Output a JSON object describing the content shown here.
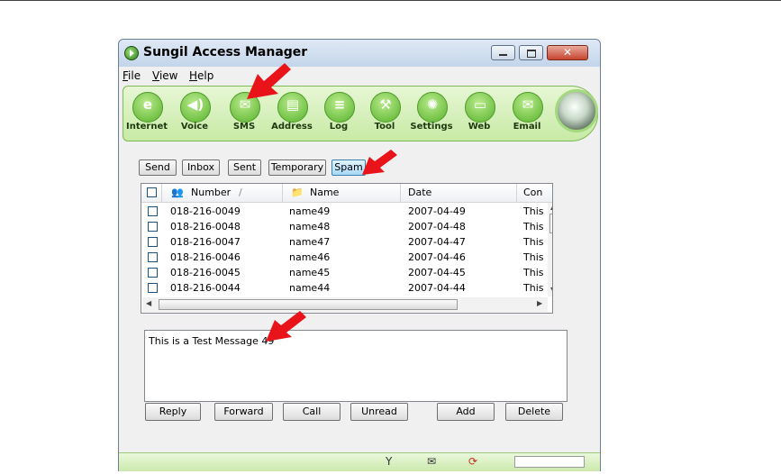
{
  "window": {
    "title": "Sungil Access Manager"
  },
  "menu": [
    "File",
    "View",
    "Help"
  ],
  "toolbar": [
    {
      "label": "Internet",
      "icon": "internet-icon",
      "glyph": "e"
    },
    {
      "label": "Voice",
      "icon": "speaker-icon",
      "glyph": "◀)"
    },
    {
      "label": "SMS",
      "icon": "envelope-icon",
      "glyph": "✉"
    },
    {
      "label": "Address",
      "icon": "address-book-icon",
      "glyph": "▤"
    },
    {
      "label": "Log",
      "icon": "log-icon",
      "glyph": "≡"
    },
    {
      "label": "Tool",
      "icon": "tool-icon",
      "glyph": "⚒"
    },
    {
      "label": "Settings",
      "icon": "gear-icon",
      "glyph": "✺"
    },
    {
      "label": "Web",
      "icon": "web-icon",
      "glyph": "▭"
    },
    {
      "label": "Email",
      "icon": "email-icon",
      "glyph": "✉"
    }
  ],
  "sms_tabs": [
    "Send",
    "Inbox",
    "Sent",
    "Temporary",
    "Spam"
  ],
  "active_tab": "Spam",
  "list": {
    "headers": {
      "number": "Number",
      "name": "Name",
      "date": "Date",
      "content": "Con"
    },
    "rows": [
      {
        "number": "018-216-0049",
        "name": "name49",
        "date": "2007-04-49",
        "content": "This"
      },
      {
        "number": "018-216-0048",
        "name": "name48",
        "date": "2007-04-48",
        "content": "This"
      },
      {
        "number": "018-216-0047",
        "name": "name47",
        "date": "2007-04-47",
        "content": "This"
      },
      {
        "number": "018-216-0046",
        "name": "name46",
        "date": "2007-04-46",
        "content": "This"
      },
      {
        "number": "018-216-0045",
        "name": "name45",
        "date": "2007-04-45",
        "content": "This"
      },
      {
        "number": "018-216-0044",
        "name": "name44",
        "date": "2007-04-44",
        "content": "This"
      }
    ]
  },
  "message": "This is a Test Message 49",
  "actions": [
    "Reply",
    "Forward",
    "Call",
    "Unread",
    "Add",
    "Delete"
  ],
  "colors": {
    "accent_green": "#58b22c",
    "arrow_red": "#e8141a",
    "active_tab": "#a7d8f6"
  }
}
